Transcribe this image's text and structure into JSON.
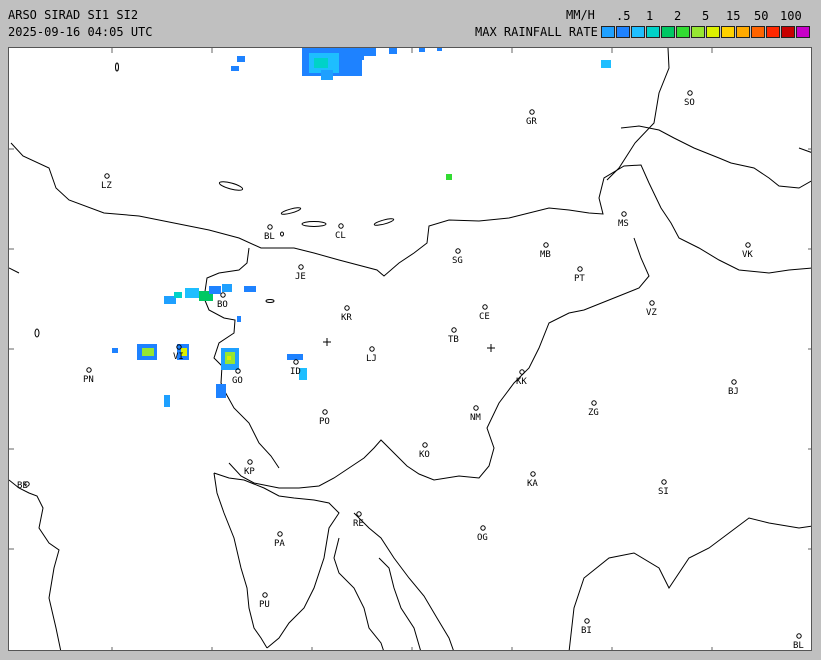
{
  "header": {
    "line1": "ARSO SIRAD SI1 SI2",
    "line2": "2025-09-16 04:05 UTC",
    "unit_label": "MM/H",
    "scale_title": "MAX RAINFALL RATE"
  },
  "scale": {
    "labels": [
      ".5",
      "1",
      "2",
      "5",
      "15",
      "50",
      "100"
    ],
    "colors": [
      "#1ea0ff",
      "#1e82ff",
      "#1ebeff",
      "#00d2c8",
      "#00c864",
      "#32dc32",
      "#96e632",
      "#dcf000",
      "#ffd200",
      "#ffaa00",
      "#ff6400",
      "#ff2800",
      "#c80000",
      "#c800c8"
    ]
  },
  "cities": [
    {
      "code": "SO"
    },
    {
      "code": "GR"
    },
    {
      "code": "LZ"
    },
    {
      "code": "MS"
    },
    {
      "code": "BL"
    },
    {
      "code": "CL"
    },
    {
      "code": "MB"
    },
    {
      "code": "VK"
    },
    {
      "code": "SG"
    },
    {
      "code": "JE"
    },
    {
      "code": "PT"
    },
    {
      "code": "BO"
    },
    {
      "code": "KR"
    },
    {
      "code": "CE"
    },
    {
      "code": "VZ"
    },
    {
      "code": "TB"
    },
    {
      "code": "LJ"
    },
    {
      "code": "VI"
    },
    {
      "code": "PN"
    },
    {
      "code": "KK"
    },
    {
      "code": "GO"
    },
    {
      "code": "ID"
    },
    {
      "code": "BJ"
    },
    {
      "code": "ZG"
    },
    {
      "code": "NM"
    },
    {
      "code": "PO"
    },
    {
      "code": "KO"
    },
    {
      "code": "KP"
    },
    {
      "code": "KA"
    },
    {
      "code": "SI"
    },
    {
      "code": "BE"
    },
    {
      "code": "RE"
    },
    {
      "code": "PA"
    },
    {
      "code": "OG"
    },
    {
      "code": "PU"
    },
    {
      "code": "BI"
    },
    {
      "code": "BL"
    }
  ]
}
